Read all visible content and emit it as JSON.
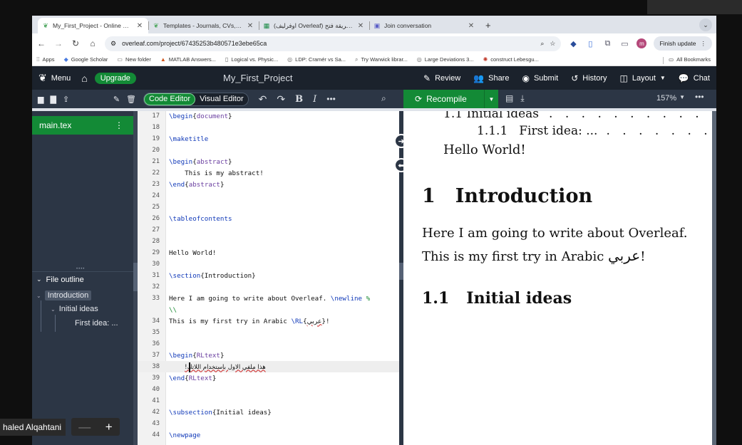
{
  "browser": {
    "tabs": [
      {
        "title": "My_First_Project - Online LaTeX",
        "active": true
      },
      {
        "title": "Templates - Journals, CVs, Pr",
        "active": false
      },
      {
        "title": "(اوفرليف Overleaf) طريقة فتح ←",
        "active": false
      },
      {
        "title": "Join conversation",
        "active": false
      }
    ],
    "url": "overleaf.com/project/67435253b480571e3ebe65ca",
    "finish_update": "Finish update",
    "avatar_letter": "m",
    "bookmarks": [
      "Apps",
      "Google Scholar",
      "New folder",
      "MATLAB Answers...",
      "Logical vs. Physic...",
      "LDP: Cramér vs Sa...",
      "Try Warwick librar...",
      "Large Deviations 3...",
      "construct Lebesgu..."
    ],
    "all_bookmarks": "All Bookmarks"
  },
  "overleaf": {
    "menu": "Menu",
    "upgrade": "Upgrade",
    "project_title": "My_First_Project",
    "header_actions": [
      "Review",
      "Share",
      "Submit",
      "History",
      "Layout",
      "Chat"
    ],
    "code_editor": "Code Editor",
    "visual_editor": "Visual Editor",
    "recompile": "Recompile",
    "zoom": "157%",
    "file": "main.tex",
    "outline_title": "File outline",
    "outline": [
      "Introduction",
      "Initial ideas",
      "First idea: ..."
    ]
  },
  "editor": {
    "lines": [
      {
        "n": "17",
        "parts": [
          [
            "kw",
            "\\begin"
          ],
          [
            "",
            "{"
          ],
          [
            "arg",
            "document"
          ],
          [
            "",
            "}"
          ]
        ]
      },
      {
        "n": "18",
        "parts": []
      },
      {
        "n": "19",
        "parts": [
          [
            "kw",
            "\\maketitle"
          ]
        ]
      },
      {
        "n": "20",
        "parts": []
      },
      {
        "n": "21",
        "parts": [
          [
            "kw",
            "\\begin"
          ],
          [
            "",
            "{"
          ],
          [
            "arg",
            "abstract"
          ],
          [
            "",
            "}"
          ]
        ]
      },
      {
        "n": "22",
        "parts": [
          [
            "",
            "    This is my abstract!"
          ]
        ]
      },
      {
        "n": "23",
        "parts": [
          [
            "kw",
            "\\end"
          ],
          [
            "",
            "{"
          ],
          [
            "arg",
            "abstract"
          ],
          [
            "",
            "}"
          ]
        ]
      },
      {
        "n": "24",
        "parts": []
      },
      {
        "n": "25",
        "parts": []
      },
      {
        "n": "26",
        "parts": [
          [
            "kw",
            "\\tableofcontents"
          ]
        ]
      },
      {
        "n": "27",
        "parts": []
      },
      {
        "n": "28",
        "parts": []
      },
      {
        "n": "29",
        "parts": [
          [
            "",
            "Hello World!"
          ]
        ]
      },
      {
        "n": "30",
        "parts": []
      },
      {
        "n": "31",
        "parts": [
          [
            "kw",
            "\\section"
          ],
          [
            "",
            "{Introduction}"
          ]
        ]
      },
      {
        "n": "32",
        "parts": []
      },
      {
        "n": "33",
        "parts": [
          [
            "",
            "Here I am going to write about Overleaf. "
          ],
          [
            "kw",
            "\\newline"
          ],
          [
            "cm",
            " %"
          ]
        ]
      },
      {
        "n": "",
        "parts": [
          [
            "cm",
            "\\\\"
          ]
        ]
      },
      {
        "n": "34",
        "parts": [
          [
            "",
            "This is my first try in Arabic "
          ],
          [
            "kw",
            "\\RL"
          ],
          [
            "",
            "{"
          ],
          [
            "sq",
            "عربي"
          ],
          [
            "",
            "}!"
          ]
        ]
      },
      {
        "n": "35",
        "parts": []
      },
      {
        "n": "36",
        "parts": []
      },
      {
        "n": "37",
        "parts": [
          [
            "kw",
            "\\begin"
          ],
          [
            "",
            "{"
          ],
          [
            "arg",
            "RLtext"
          ],
          [
            "",
            "}"
          ]
        ]
      },
      {
        "n": "38",
        "parts": [
          [
            "",
            "    "
          ],
          [
            "sqrtl",
            "هذا ملفي الاول باستخدام اللاتك!"
          ]
        ]
      },
      {
        "n": "39",
        "parts": [
          [
            "kw",
            "\\end"
          ],
          [
            "",
            "{"
          ],
          [
            "arg",
            "RLtext"
          ],
          [
            "",
            "}"
          ]
        ]
      },
      {
        "n": "40",
        "parts": []
      },
      {
        "n": "41",
        "parts": []
      },
      {
        "n": "42",
        "parts": [
          [
            "kw",
            "\\subsection"
          ],
          [
            "",
            "{Initial ideas}"
          ]
        ]
      },
      {
        "n": "43",
        "parts": []
      },
      {
        "n": "44",
        "parts": [
          [
            "kw",
            "\\newpage"
          ]
        ]
      }
    ]
  },
  "pdf": {
    "toc_sub": "1.1   Initial ideas",
    "toc_subsub_num": "1.1.1",
    "toc_subsub_title": "First idea: ...",
    "hello": "Hello World!",
    "section_num": "1",
    "section_title": "Introduction",
    "para1": "Here I am going to write about Overleaf.",
    "para2_prefix": "This is my first try in Arabic ",
    "para2_arabic": "عربي",
    "para2_suffix": "!",
    "subsection_num": "1.1",
    "subsection_title": "Initial ideas"
  },
  "call": {
    "participant": "haled Alqahtani"
  }
}
